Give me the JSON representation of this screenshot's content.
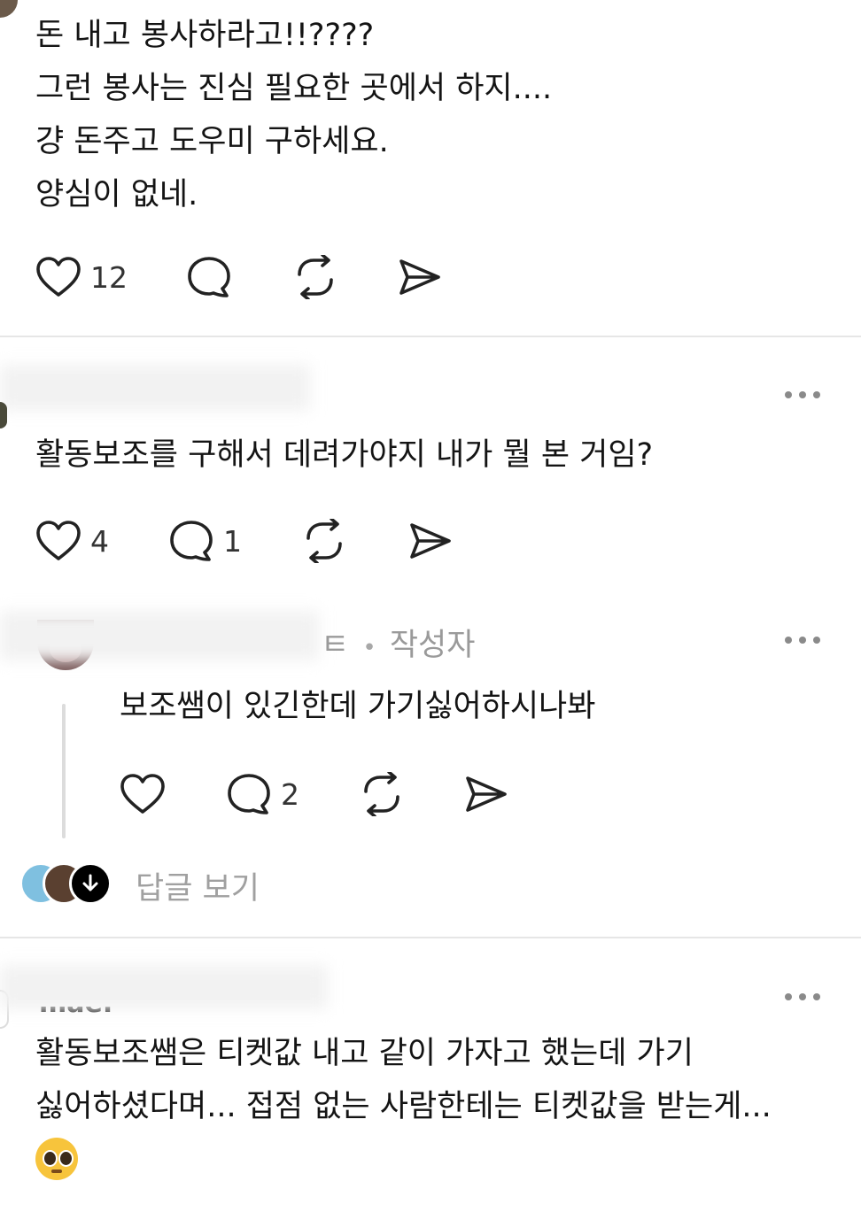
{
  "post1": {
    "lines": [
      "돈 내고 봉사하라고!!????",
      "그런 봉사는 진심 필요한 곳에서 하지....",
      "걍 돈주고 도우미 구하세요.",
      "양심이 없네."
    ],
    "likes": "12"
  },
  "post2": {
    "text": "활동보조를 구해서 데려가야지 내가 뭘 본 거임?",
    "likes": "4",
    "replies": "1"
  },
  "reply": {
    "author_suffix": "ㅌ",
    "separator": "•",
    "author_badge": "작성자",
    "text": "보조쌤이 있긴한데 가기싫어하시나봐",
    "replies": "2",
    "view_replies": "답글 보기"
  },
  "post3": {
    "handle_fragment": "mae.",
    "lines": [
      "활동보조쌤은 티켓값 내고 같이 가자고 했는데 가기",
      "싫어하셨다며... 접점 없는 사람한테는 티켓값을 받는게..."
    ],
    "emoji": "🥺"
  },
  "icons": [
    "heart-icon",
    "comment-icon",
    "repost-icon",
    "share-icon",
    "more-icon",
    "arrow-down-icon"
  ]
}
